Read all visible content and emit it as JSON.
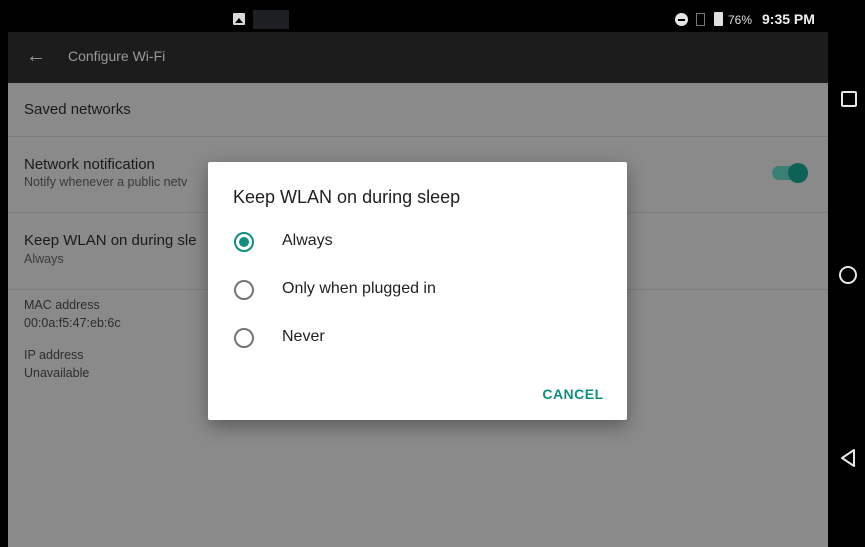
{
  "status_bar": {
    "battery_percent": "76%",
    "time": "9:35 PM"
  },
  "app_bar": {
    "title": "Configure Wi-Fi"
  },
  "settings": {
    "saved_networks": "Saved networks",
    "network_notification": {
      "title": "Network notification",
      "summary": "Notify whenever a public netv",
      "toggle_on": true
    },
    "keep_wlan": {
      "title": "Keep WLAN on during sle",
      "summary": "Always"
    },
    "mac_address": {
      "label": "MAC address",
      "value": "00:0a:f5:47:eb:6c"
    },
    "ip_address": {
      "label": "IP address",
      "value": "Unavailable"
    }
  },
  "dialog": {
    "title": "Keep WLAN on during sleep",
    "options": [
      {
        "label": "Always",
        "selected": true
      },
      {
        "label": "Only when plugged in",
        "selected": false
      },
      {
        "label": "Never",
        "selected": false
      }
    ],
    "cancel_label": "CANCEL"
  },
  "colors": {
    "accent": "#0f8f7f",
    "dim_background": "#8a8a8a",
    "app_bar": "#1c1c1c"
  }
}
